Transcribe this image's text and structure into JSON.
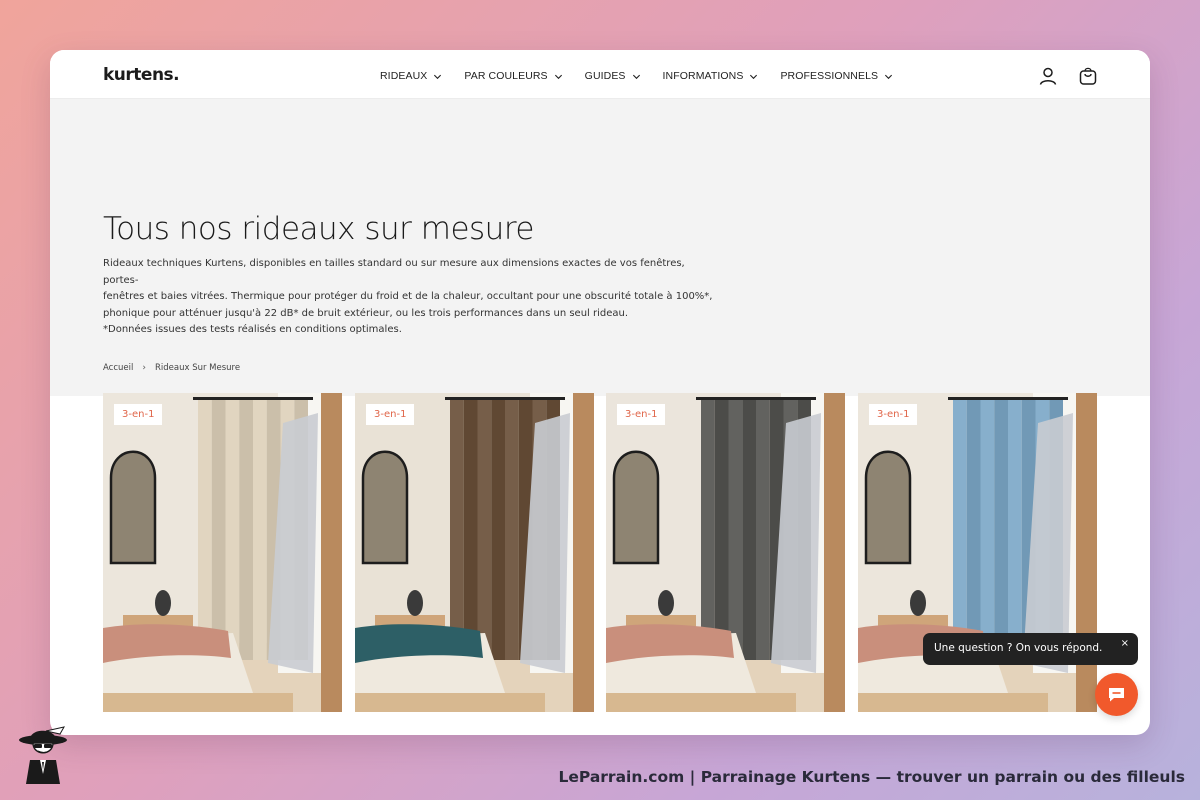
{
  "header": {
    "logo": "kurtens.",
    "nav": [
      {
        "label": "RIDEAUX"
      },
      {
        "label": "PAR COULEURS"
      },
      {
        "label": "GUIDES"
      },
      {
        "label": "INFORMATIONS"
      },
      {
        "label": "PROFESSIONNELS"
      }
    ],
    "icons": [
      "account-icon",
      "cart-icon"
    ]
  },
  "hero": {
    "title": "Tous nos rideaux sur mesure",
    "description_lines": [
      "Rideaux techniques Kurtens, disponibles en tailles standard ou sur mesure aux dimensions exactes de vos fenêtres, portes-",
      "fenêtres et baies vitrées. Thermique pour protéger du froid et de la chaleur, occultant pour une obscurité totale à 100%*,",
      "phonique pour atténuer jusqu'à 22 dB* de bruit extérieur, ou les trois performances dans un seul rideau.",
      "*Données issues des tests réalisés en conditions optimales."
    ]
  },
  "breadcrumb": {
    "items": [
      "Accueil",
      "Rideaux Sur Mesure"
    ],
    "separator": "›"
  },
  "products": [
    {
      "badge": "3-en-1",
      "curtain_color": "#d9cdb8",
      "bed_color": "#c98f7c",
      "wall_color": "#ece6dc"
    },
    {
      "badge": "3-en-1",
      "curtain_color": "#6e5641",
      "bed_color": "#2d5f66",
      "wall_color": "#e9e2d6"
    },
    {
      "badge": "3-en-1",
      "curtain_color": "#5a5a57",
      "bed_color": "#c98f7c",
      "wall_color": "#ebe5dc"
    },
    {
      "badge": "3-en-1",
      "curtain_color": "#7fa7c4",
      "bed_color": "#c98f7c",
      "wall_color": "#ece6dc"
    }
  ],
  "chat": {
    "message": "Une question ? On vous répond.",
    "close": "×"
  },
  "footer": {
    "text": "LeParrain.com | Parrainage Kurtens — trouver un parrain ou des filleuls"
  },
  "colors": {
    "accent": "#f1592c",
    "badge_text": "#e0664a",
    "hero_bg": "#f3f3f3"
  }
}
